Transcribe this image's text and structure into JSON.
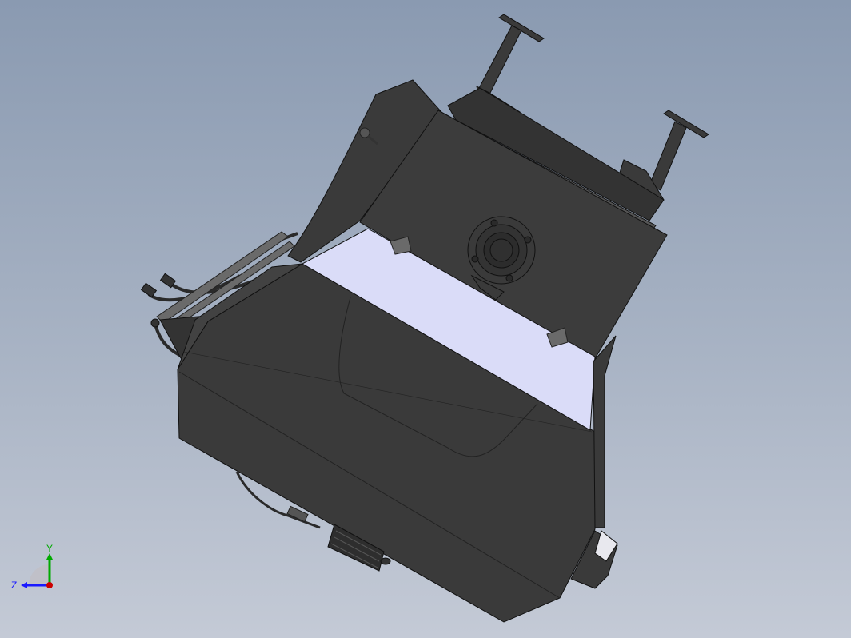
{
  "viewport": {
    "background_top": "#8a9ab1",
    "background_bottom": "#c4cad6"
  },
  "model": {
    "body_color": "#3a3a3a",
    "dark_color": "#2a2a2a",
    "panel_color": "#dadcf8",
    "edge_color": "#111111"
  },
  "triad": {
    "x_color": "#cc0000",
    "y_color": "#00aa00",
    "z_color": "#1a1aff",
    "y_label": "Y",
    "z_label": "Z"
  }
}
